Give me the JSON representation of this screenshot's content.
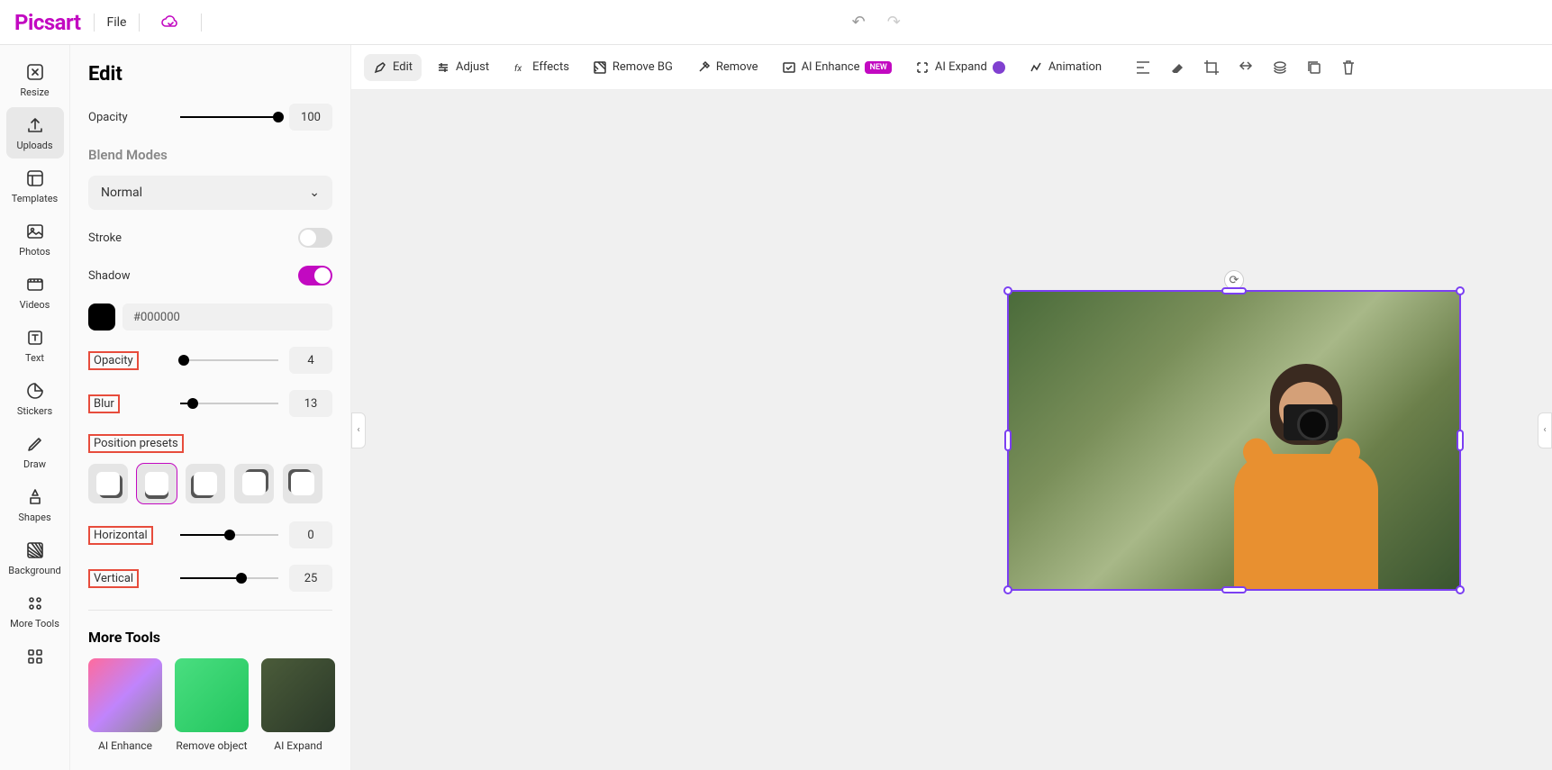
{
  "topbar": {
    "logo": "Picsart",
    "file": "File"
  },
  "rail": {
    "items": [
      {
        "label": "Resize"
      },
      {
        "label": "Uploads"
      },
      {
        "label": "Templates"
      },
      {
        "label": "Photos"
      },
      {
        "label": "Videos"
      },
      {
        "label": "Text"
      },
      {
        "label": "Stickers"
      },
      {
        "label": "Draw"
      },
      {
        "label": "Shapes"
      },
      {
        "label": "Background"
      },
      {
        "label": "More Tools"
      }
    ]
  },
  "panel": {
    "title": "Edit",
    "opacity_label": "Opacity",
    "opacity_value": "100",
    "blend_title": "Blend Modes",
    "blend_value": "Normal",
    "stroke_label": "Stroke",
    "shadow_label": "Shadow",
    "shadow_color": "#000000",
    "shadow_opacity_label": "Opacity",
    "shadow_opacity_value": "4",
    "blur_label": "Blur",
    "blur_value": "13",
    "position_label": "Position presets",
    "horizontal_label": "Horizontal",
    "horizontal_value": "0",
    "vertical_label": "Vertical",
    "vertical_value": "25",
    "more_title": "More Tools",
    "tools": [
      {
        "label": "AI Enhance"
      },
      {
        "label": "Remove object"
      },
      {
        "label": "AI Expand"
      }
    ]
  },
  "toolbar": {
    "edit": "Edit",
    "adjust": "Adjust",
    "effects": "Effects",
    "removebg": "Remove BG",
    "remove": "Remove",
    "aienhance": "AI Enhance",
    "aienhance_badge": "NEW",
    "aiexpand": "AI Expand",
    "animation": "Animation"
  }
}
